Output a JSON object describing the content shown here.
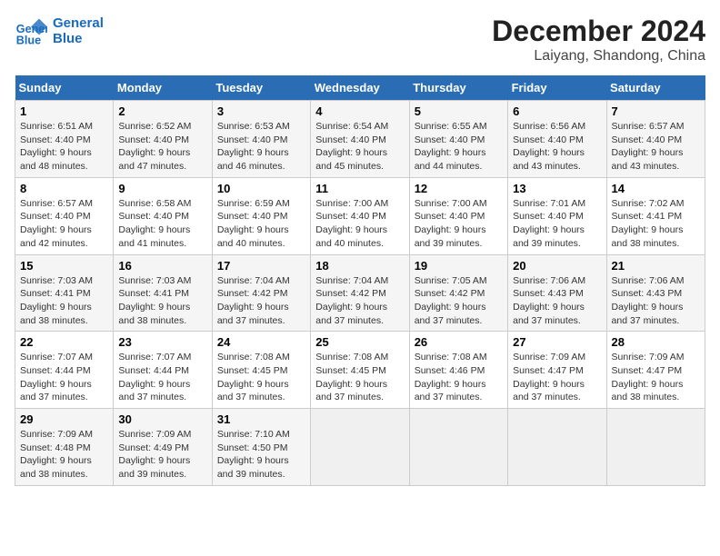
{
  "header": {
    "logo_line1": "General",
    "logo_line2": "Blue",
    "month": "December 2024",
    "location": "Laiyang, Shandong, China"
  },
  "weekdays": [
    "Sunday",
    "Monday",
    "Tuesday",
    "Wednesday",
    "Thursday",
    "Friday",
    "Saturday"
  ],
  "weeks": [
    [
      {
        "day": "1",
        "detail": "Sunrise: 6:51 AM\nSunset: 4:40 PM\nDaylight: 9 hours and 48 minutes."
      },
      {
        "day": "2",
        "detail": "Sunrise: 6:52 AM\nSunset: 4:40 PM\nDaylight: 9 hours and 47 minutes."
      },
      {
        "day": "3",
        "detail": "Sunrise: 6:53 AM\nSunset: 4:40 PM\nDaylight: 9 hours and 46 minutes."
      },
      {
        "day": "4",
        "detail": "Sunrise: 6:54 AM\nSunset: 4:40 PM\nDaylight: 9 hours and 45 minutes."
      },
      {
        "day": "5",
        "detail": "Sunrise: 6:55 AM\nSunset: 4:40 PM\nDaylight: 9 hours and 44 minutes."
      },
      {
        "day": "6",
        "detail": "Sunrise: 6:56 AM\nSunset: 4:40 PM\nDaylight: 9 hours and 43 minutes."
      },
      {
        "day": "7",
        "detail": "Sunrise: 6:57 AM\nSunset: 4:40 PM\nDaylight: 9 hours and 43 minutes."
      }
    ],
    [
      {
        "day": "8",
        "detail": "Sunrise: 6:57 AM\nSunset: 4:40 PM\nDaylight: 9 hours and 42 minutes."
      },
      {
        "day": "9",
        "detail": "Sunrise: 6:58 AM\nSunset: 4:40 PM\nDaylight: 9 hours and 41 minutes."
      },
      {
        "day": "10",
        "detail": "Sunrise: 6:59 AM\nSunset: 4:40 PM\nDaylight: 9 hours and 40 minutes."
      },
      {
        "day": "11",
        "detail": "Sunrise: 7:00 AM\nSunset: 4:40 PM\nDaylight: 9 hours and 40 minutes."
      },
      {
        "day": "12",
        "detail": "Sunrise: 7:00 AM\nSunset: 4:40 PM\nDaylight: 9 hours and 39 minutes."
      },
      {
        "day": "13",
        "detail": "Sunrise: 7:01 AM\nSunset: 4:40 PM\nDaylight: 9 hours and 39 minutes."
      },
      {
        "day": "14",
        "detail": "Sunrise: 7:02 AM\nSunset: 4:41 PM\nDaylight: 9 hours and 38 minutes."
      }
    ],
    [
      {
        "day": "15",
        "detail": "Sunrise: 7:03 AM\nSunset: 4:41 PM\nDaylight: 9 hours and 38 minutes."
      },
      {
        "day": "16",
        "detail": "Sunrise: 7:03 AM\nSunset: 4:41 PM\nDaylight: 9 hours and 38 minutes."
      },
      {
        "day": "17",
        "detail": "Sunrise: 7:04 AM\nSunset: 4:42 PM\nDaylight: 9 hours and 37 minutes."
      },
      {
        "day": "18",
        "detail": "Sunrise: 7:04 AM\nSunset: 4:42 PM\nDaylight: 9 hours and 37 minutes."
      },
      {
        "day": "19",
        "detail": "Sunrise: 7:05 AM\nSunset: 4:42 PM\nDaylight: 9 hours and 37 minutes."
      },
      {
        "day": "20",
        "detail": "Sunrise: 7:06 AM\nSunset: 4:43 PM\nDaylight: 9 hours and 37 minutes."
      },
      {
        "day": "21",
        "detail": "Sunrise: 7:06 AM\nSunset: 4:43 PM\nDaylight: 9 hours and 37 minutes."
      }
    ],
    [
      {
        "day": "22",
        "detail": "Sunrise: 7:07 AM\nSunset: 4:44 PM\nDaylight: 9 hours and 37 minutes."
      },
      {
        "day": "23",
        "detail": "Sunrise: 7:07 AM\nSunset: 4:44 PM\nDaylight: 9 hours and 37 minutes."
      },
      {
        "day": "24",
        "detail": "Sunrise: 7:08 AM\nSunset: 4:45 PM\nDaylight: 9 hours and 37 minutes."
      },
      {
        "day": "25",
        "detail": "Sunrise: 7:08 AM\nSunset: 4:45 PM\nDaylight: 9 hours and 37 minutes."
      },
      {
        "day": "26",
        "detail": "Sunrise: 7:08 AM\nSunset: 4:46 PM\nDaylight: 9 hours and 37 minutes."
      },
      {
        "day": "27",
        "detail": "Sunrise: 7:09 AM\nSunset: 4:47 PM\nDaylight: 9 hours and 37 minutes."
      },
      {
        "day": "28",
        "detail": "Sunrise: 7:09 AM\nSunset: 4:47 PM\nDaylight: 9 hours and 38 minutes."
      }
    ],
    [
      {
        "day": "29",
        "detail": "Sunrise: 7:09 AM\nSunset: 4:48 PM\nDaylight: 9 hours and 38 minutes."
      },
      {
        "day": "30",
        "detail": "Sunrise: 7:09 AM\nSunset: 4:49 PM\nDaylight: 9 hours and 39 minutes."
      },
      {
        "day": "31",
        "detail": "Sunrise: 7:10 AM\nSunset: 4:50 PM\nDaylight: 9 hours and 39 minutes."
      },
      null,
      null,
      null,
      null
    ]
  ]
}
